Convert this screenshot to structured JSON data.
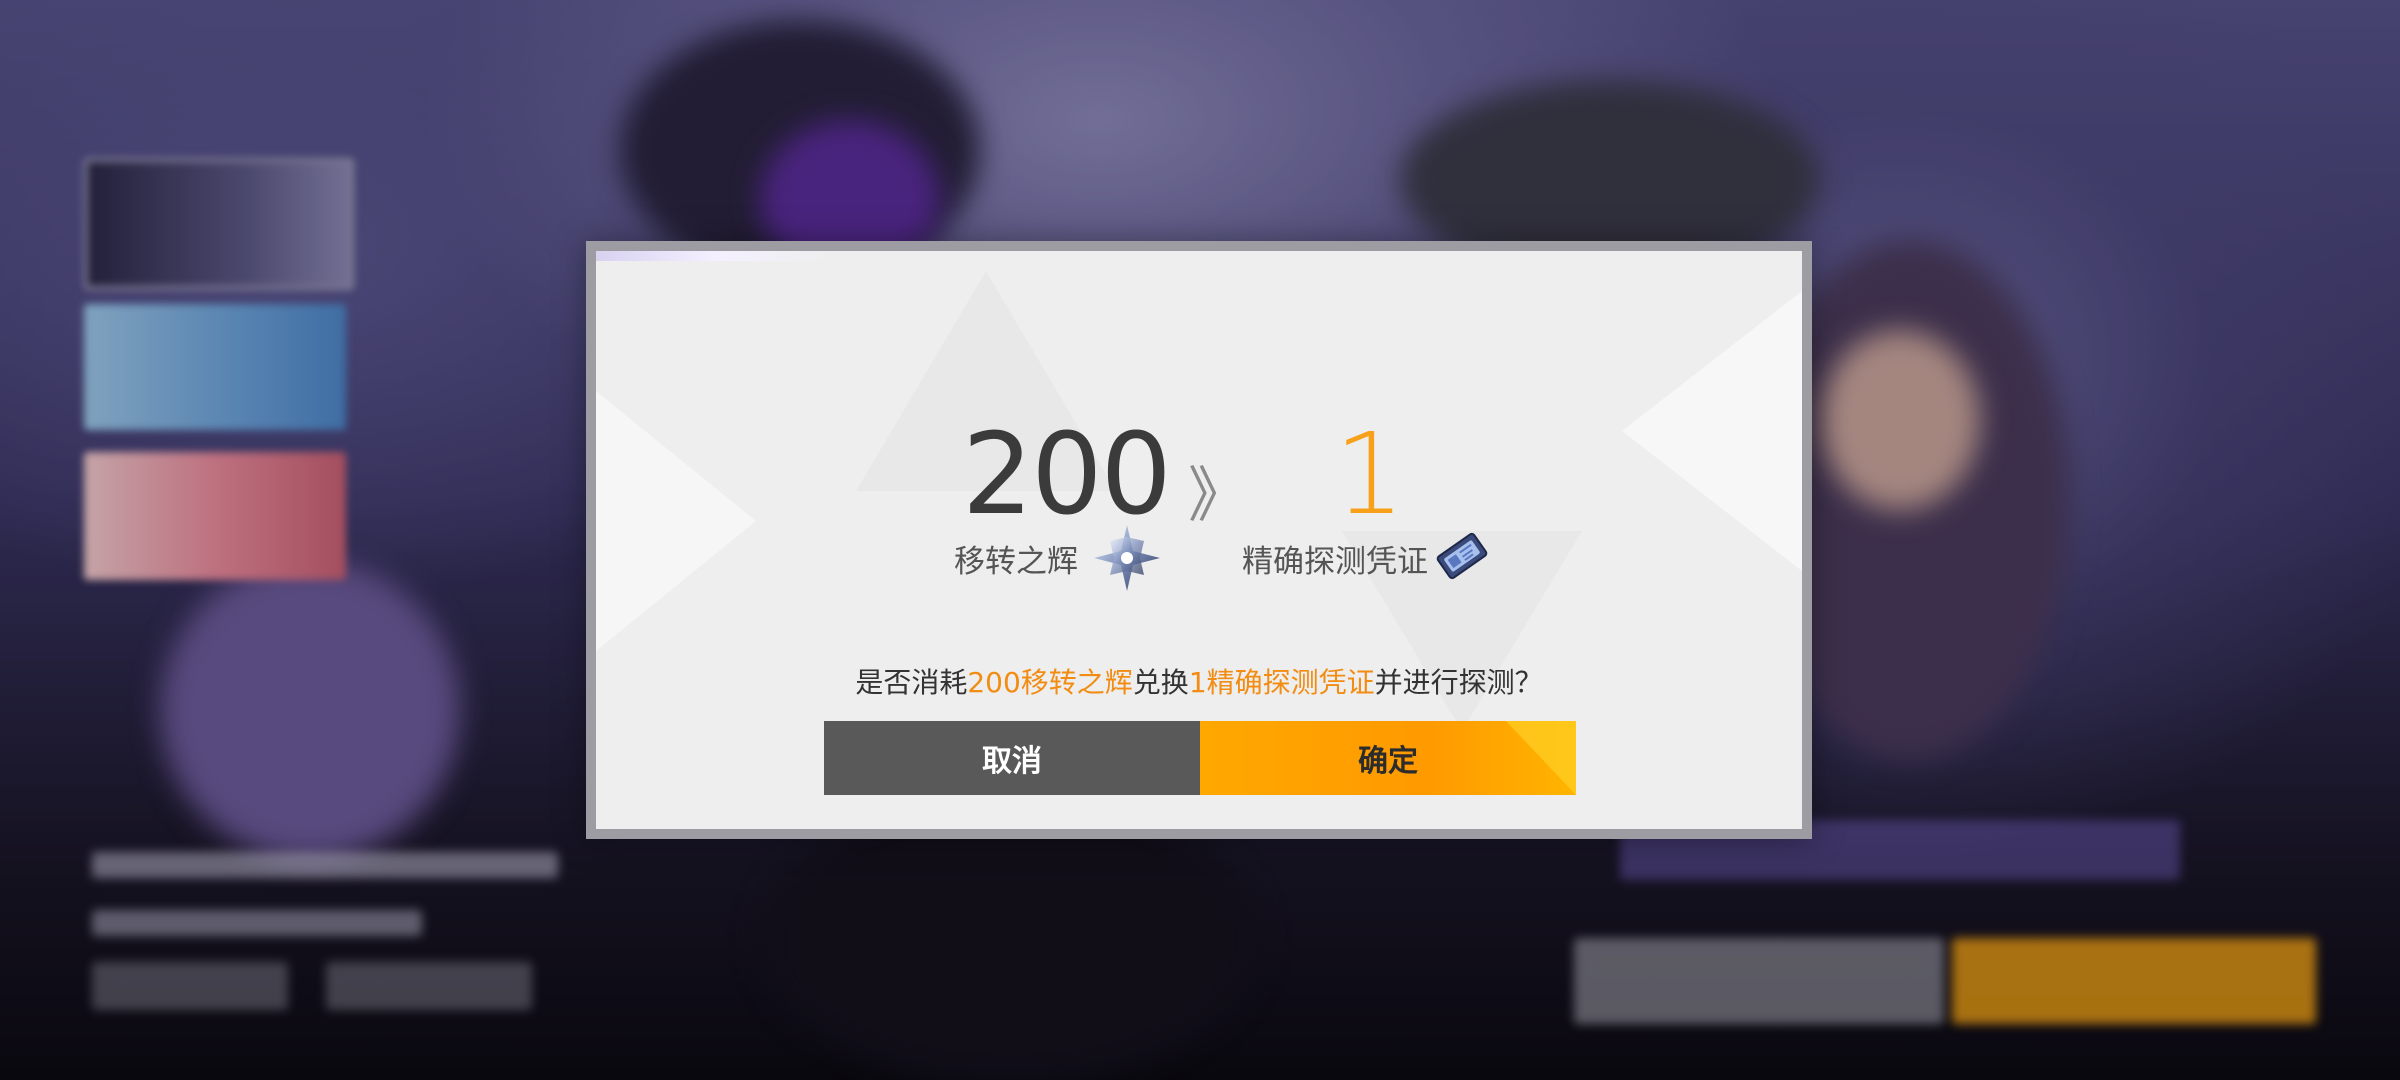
{
  "background": {
    "menu_items": [
      "",
      "",
      ""
    ]
  },
  "dialog": {
    "cost": {
      "amount": "200",
      "item_name": "移转之辉",
      "icon": "star-shard-icon"
    },
    "separator_icon": "double-chevron-right-icon",
    "separator_glyph": "》",
    "gain": {
      "amount": "1",
      "item_name": "精确探测凭证",
      "icon": "ticket-icon"
    },
    "question": {
      "prefix": "是否消耗",
      "cost_text": "200移转之辉",
      "middle": "兑换",
      "gain_text": "1精确探测凭证",
      "suffix": "并进行探测？"
    },
    "buttons": {
      "cancel_label": "取消",
      "confirm_label": "确定"
    }
  },
  "colors": {
    "accent_orange": "#f7a11a",
    "highlight_text": "#f28c12",
    "cancel_bg": "#595959",
    "confirm_bg": "#ffa800",
    "dialog_bg": "#eeeeee",
    "dialog_border": "#9c9ca2"
  }
}
